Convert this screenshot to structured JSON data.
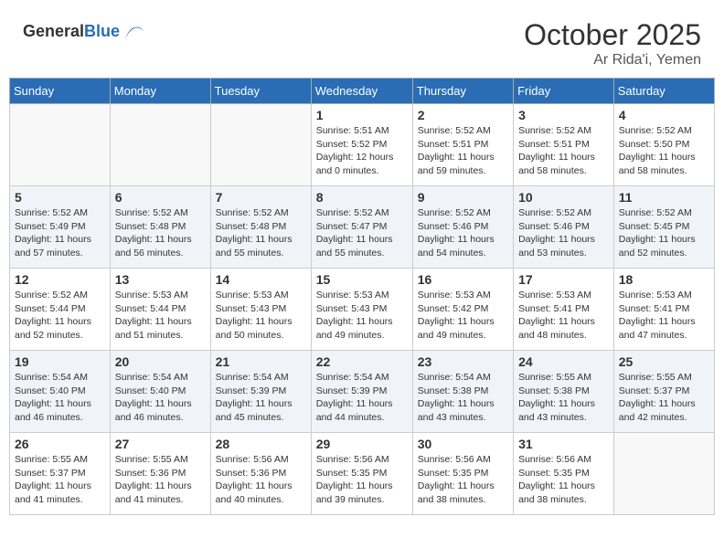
{
  "header": {
    "logo_general": "General",
    "logo_blue": "Blue",
    "month": "October 2025",
    "location": "Ar Rida'i, Yemen"
  },
  "weekdays": [
    "Sunday",
    "Monday",
    "Tuesday",
    "Wednesday",
    "Thursday",
    "Friday",
    "Saturday"
  ],
  "weeks": [
    [
      {
        "day": "",
        "detail": ""
      },
      {
        "day": "",
        "detail": ""
      },
      {
        "day": "",
        "detail": ""
      },
      {
        "day": "1",
        "detail": "Sunrise: 5:51 AM\nSunset: 5:52 PM\nDaylight: 12 hours\nand 0 minutes."
      },
      {
        "day": "2",
        "detail": "Sunrise: 5:52 AM\nSunset: 5:51 PM\nDaylight: 11 hours\nand 59 minutes."
      },
      {
        "day": "3",
        "detail": "Sunrise: 5:52 AM\nSunset: 5:51 PM\nDaylight: 11 hours\nand 58 minutes."
      },
      {
        "day": "4",
        "detail": "Sunrise: 5:52 AM\nSunset: 5:50 PM\nDaylight: 11 hours\nand 58 minutes."
      }
    ],
    [
      {
        "day": "5",
        "detail": "Sunrise: 5:52 AM\nSunset: 5:49 PM\nDaylight: 11 hours\nand 57 minutes."
      },
      {
        "day": "6",
        "detail": "Sunrise: 5:52 AM\nSunset: 5:48 PM\nDaylight: 11 hours\nand 56 minutes."
      },
      {
        "day": "7",
        "detail": "Sunrise: 5:52 AM\nSunset: 5:48 PM\nDaylight: 11 hours\nand 55 minutes."
      },
      {
        "day": "8",
        "detail": "Sunrise: 5:52 AM\nSunset: 5:47 PM\nDaylight: 11 hours\nand 55 minutes."
      },
      {
        "day": "9",
        "detail": "Sunrise: 5:52 AM\nSunset: 5:46 PM\nDaylight: 11 hours\nand 54 minutes."
      },
      {
        "day": "10",
        "detail": "Sunrise: 5:52 AM\nSunset: 5:46 PM\nDaylight: 11 hours\nand 53 minutes."
      },
      {
        "day": "11",
        "detail": "Sunrise: 5:52 AM\nSunset: 5:45 PM\nDaylight: 11 hours\nand 52 minutes."
      }
    ],
    [
      {
        "day": "12",
        "detail": "Sunrise: 5:52 AM\nSunset: 5:44 PM\nDaylight: 11 hours\nand 52 minutes."
      },
      {
        "day": "13",
        "detail": "Sunrise: 5:53 AM\nSunset: 5:44 PM\nDaylight: 11 hours\nand 51 minutes."
      },
      {
        "day": "14",
        "detail": "Sunrise: 5:53 AM\nSunset: 5:43 PM\nDaylight: 11 hours\nand 50 minutes."
      },
      {
        "day": "15",
        "detail": "Sunrise: 5:53 AM\nSunset: 5:43 PM\nDaylight: 11 hours\nand 49 minutes."
      },
      {
        "day": "16",
        "detail": "Sunrise: 5:53 AM\nSunset: 5:42 PM\nDaylight: 11 hours\nand 49 minutes."
      },
      {
        "day": "17",
        "detail": "Sunrise: 5:53 AM\nSunset: 5:41 PM\nDaylight: 11 hours\nand 48 minutes."
      },
      {
        "day": "18",
        "detail": "Sunrise: 5:53 AM\nSunset: 5:41 PM\nDaylight: 11 hours\nand 47 minutes."
      }
    ],
    [
      {
        "day": "19",
        "detail": "Sunrise: 5:54 AM\nSunset: 5:40 PM\nDaylight: 11 hours\nand 46 minutes."
      },
      {
        "day": "20",
        "detail": "Sunrise: 5:54 AM\nSunset: 5:40 PM\nDaylight: 11 hours\nand 46 minutes."
      },
      {
        "day": "21",
        "detail": "Sunrise: 5:54 AM\nSunset: 5:39 PM\nDaylight: 11 hours\nand 45 minutes."
      },
      {
        "day": "22",
        "detail": "Sunrise: 5:54 AM\nSunset: 5:39 PM\nDaylight: 11 hours\nand 44 minutes."
      },
      {
        "day": "23",
        "detail": "Sunrise: 5:54 AM\nSunset: 5:38 PM\nDaylight: 11 hours\nand 43 minutes."
      },
      {
        "day": "24",
        "detail": "Sunrise: 5:55 AM\nSunset: 5:38 PM\nDaylight: 11 hours\nand 43 minutes."
      },
      {
        "day": "25",
        "detail": "Sunrise: 5:55 AM\nSunset: 5:37 PM\nDaylight: 11 hours\nand 42 minutes."
      }
    ],
    [
      {
        "day": "26",
        "detail": "Sunrise: 5:55 AM\nSunset: 5:37 PM\nDaylight: 11 hours\nand 41 minutes."
      },
      {
        "day": "27",
        "detail": "Sunrise: 5:55 AM\nSunset: 5:36 PM\nDaylight: 11 hours\nand 41 minutes."
      },
      {
        "day": "28",
        "detail": "Sunrise: 5:56 AM\nSunset: 5:36 PM\nDaylight: 11 hours\nand 40 minutes."
      },
      {
        "day": "29",
        "detail": "Sunrise: 5:56 AM\nSunset: 5:35 PM\nDaylight: 11 hours\nand 39 minutes."
      },
      {
        "day": "30",
        "detail": "Sunrise: 5:56 AM\nSunset: 5:35 PM\nDaylight: 11 hours\nand 38 minutes."
      },
      {
        "day": "31",
        "detail": "Sunrise: 5:56 AM\nSunset: 5:35 PM\nDaylight: 11 hours\nand 38 minutes."
      },
      {
        "day": "",
        "detail": ""
      }
    ]
  ]
}
